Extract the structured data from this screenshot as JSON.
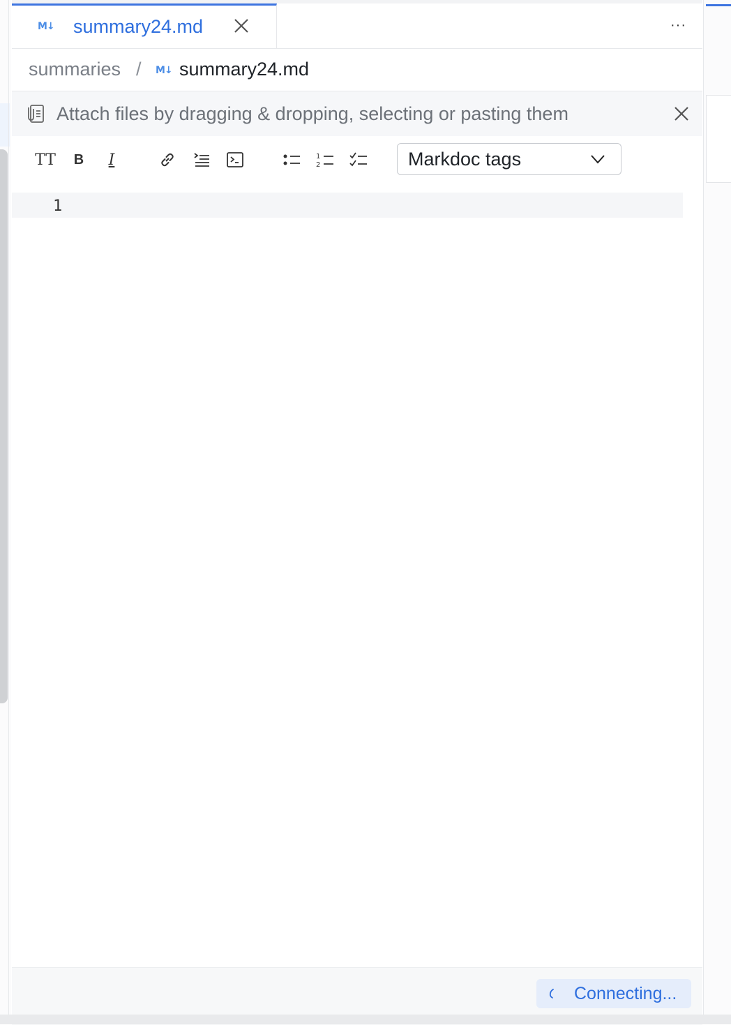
{
  "tab": {
    "icon": "markdown-icon",
    "icon_text": "M↓",
    "title": "summary24.md",
    "close_icon": "close-icon"
  },
  "header": {
    "more_label": "···"
  },
  "breadcrumb": {
    "root": "summaries",
    "separator": "/",
    "file_icon_text": "M↓",
    "file": "summary24.md"
  },
  "attach_banner": {
    "icon": "attachment-icon",
    "text": "Attach files by dragging & dropping, selecting or pasting them",
    "close_icon": "close-icon"
  },
  "toolbar": {
    "heading_label": "TT",
    "bold_label": "B",
    "italic_label": "I",
    "icons": [
      "text-size-icon",
      "bold-icon",
      "italic-icon",
      "link-icon",
      "quote-icon",
      "code-icon",
      "bulleted-list-icon",
      "numbered-list-icon",
      "task-list-icon"
    ],
    "tags_select": {
      "value": "Markdoc tags",
      "chevron": "chevron-down-icon"
    }
  },
  "editor": {
    "line_numbers": [
      "1"
    ],
    "content": ""
  },
  "status": {
    "text": "Connecting...",
    "spinner": "spinner-icon"
  },
  "colors": {
    "accent": "#3d74e0",
    "link_text": "#2f6fde",
    "status_bg": "#e5edfb"
  }
}
